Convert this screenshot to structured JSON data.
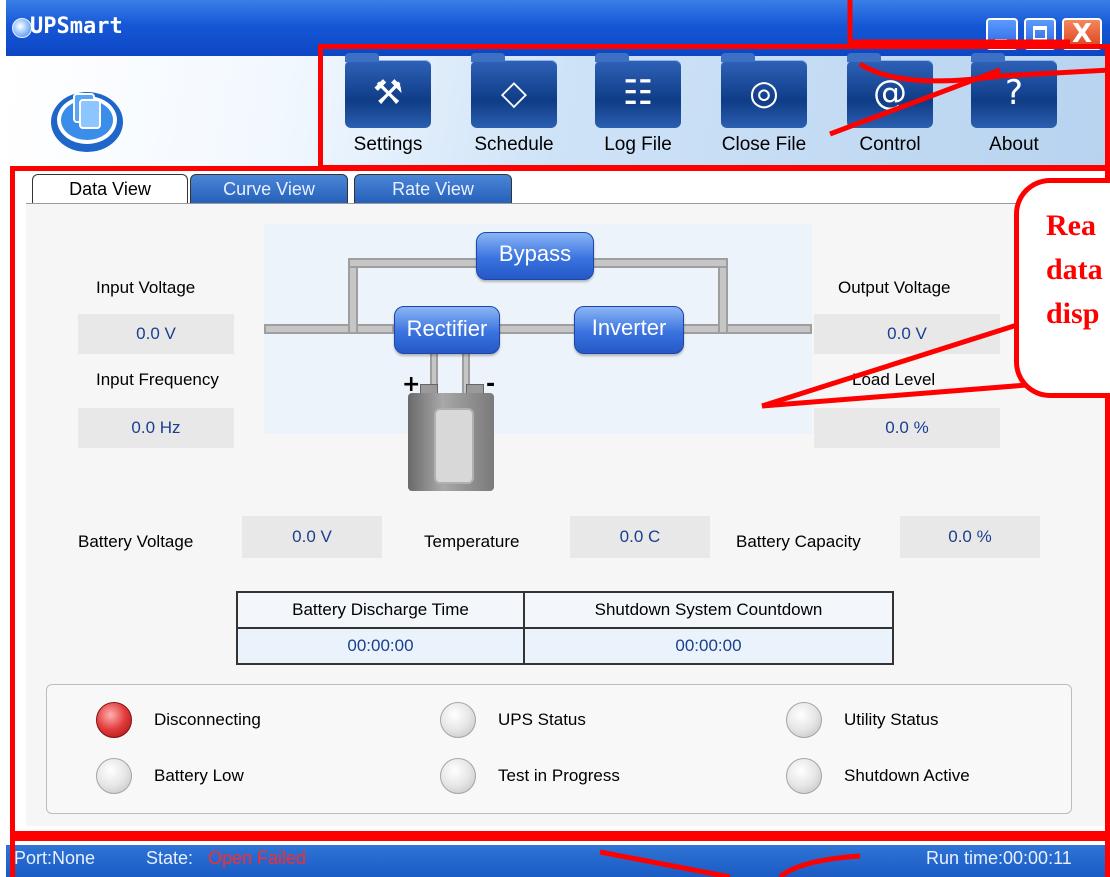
{
  "window": {
    "title": "UPSmart",
    "close_glyph": "X"
  },
  "toolbar": {
    "items": [
      {
        "label": "Settings",
        "icon": "hammer-icon",
        "glyph": "⚒"
      },
      {
        "label": "Schedule",
        "icon": "diamond-pencil-icon",
        "glyph": "◇"
      },
      {
        "label": "Log File",
        "icon": "document-icon",
        "glyph": "☷"
      },
      {
        "label": "Close File",
        "icon": "disc-icon",
        "glyph": "◎"
      },
      {
        "label": "Control",
        "icon": "at-sign-icon",
        "glyph": "@"
      },
      {
        "label": "About",
        "icon": "question-mark-icon",
        "glyph": "?"
      }
    ]
  },
  "tabs": [
    {
      "label": "Data View",
      "active": true
    },
    {
      "label": "Curve View",
      "active": false
    },
    {
      "label": "Rate View",
      "active": false
    }
  ],
  "diagram": {
    "bypass": "Bypass",
    "rectifier": "Rectifier",
    "inverter": "Inverter",
    "battery_plus": "+",
    "battery_minus": "-"
  },
  "readings": {
    "input_voltage": {
      "label": "Input Voltage",
      "value": "0.0 V"
    },
    "input_frequency": {
      "label": "Input Frequency",
      "value": "0.0 Hz"
    },
    "output_voltage": {
      "label": "Output Voltage",
      "value": "0.0 V"
    },
    "load_level": {
      "label": "Load Level",
      "value": "0.0 %"
    },
    "battery_voltage": {
      "label": "Battery Voltage",
      "value": "0.0 V"
    },
    "temperature": {
      "label": "Temperature",
      "value": "0.0 C"
    },
    "battery_capacity": {
      "label": "Battery Capacity",
      "value": "0.0 %"
    }
  },
  "time_table": {
    "headers": [
      "Battery Discharge Time",
      "Shutdown System Countdown"
    ],
    "values": [
      "00:00:00",
      "00:00:00"
    ]
  },
  "status_indicators": [
    {
      "label": "Disconnecting",
      "active": true
    },
    {
      "label": "UPS Status",
      "active": false
    },
    {
      "label": "Utility Status",
      "active": false
    },
    {
      "label": "Battery Low",
      "active": false
    },
    {
      "label": "Test in Progress",
      "active": false
    },
    {
      "label": "Shutdown Active",
      "active": false
    }
  ],
  "statusbar": {
    "port": "Port:None",
    "state_label": "State:",
    "state_value": "Open Failed",
    "run_time": "Run time:00:00:11"
  },
  "annotation": {
    "lines": [
      "Rea",
      "data",
      "disp"
    ]
  },
  "colors": {
    "annotation_red": "#ff0000",
    "state_error": "#ff2a2a",
    "title_blue": "#1657d6"
  }
}
